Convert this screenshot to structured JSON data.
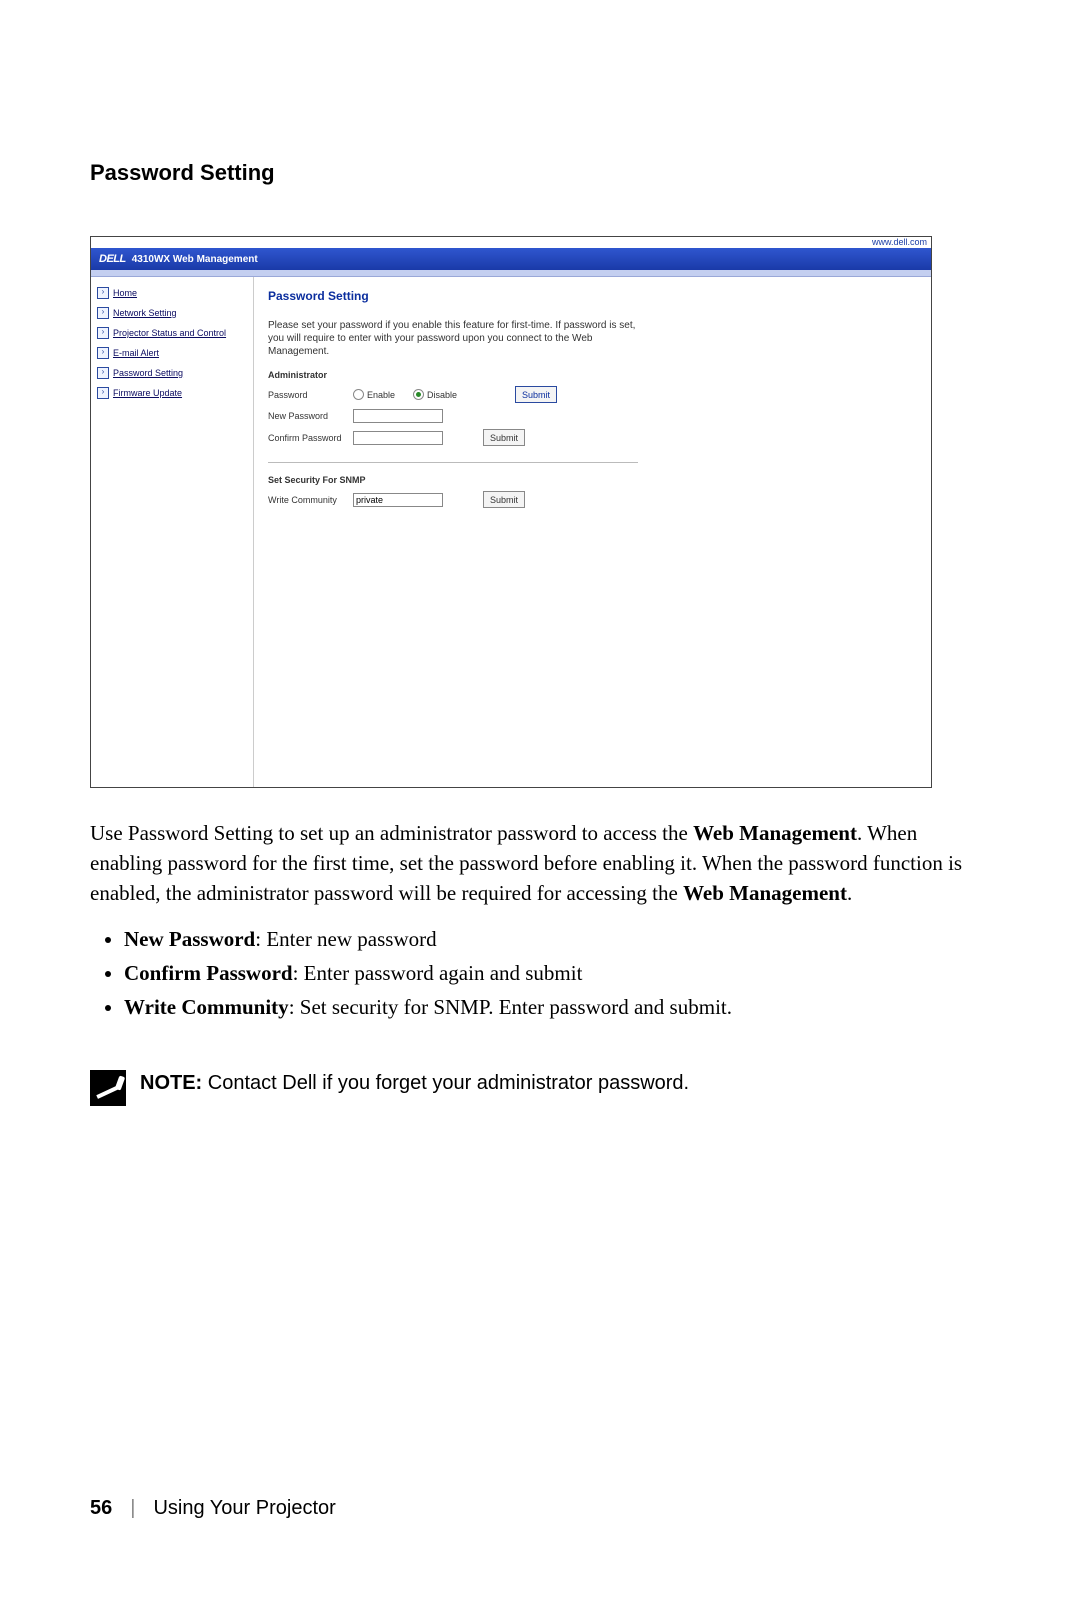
{
  "section_heading": "Password Setting",
  "screenshot": {
    "url_hint": "www.dell.com",
    "title_brand": "DELL",
    "title_text": "4310WX Web Management",
    "sidebar": [
      {
        "label": "Home"
      },
      {
        "label": "Network Setting"
      },
      {
        "label": "Projector Status and Control"
      },
      {
        "label": "E-mail Alert"
      },
      {
        "label": "Password Setting"
      },
      {
        "label": "Firmware Update"
      }
    ],
    "panel_title": "Password Setting",
    "panel_desc": "Please set your password if you enable this feature for first-time. If password is set, you will require to enter with your password upon you connect to the Web Management.",
    "admin": {
      "heading": "Administrator",
      "rows": {
        "password_label": "Password",
        "enable": "Enable",
        "disable": "Disable",
        "submit": "Submit",
        "new_pw_label": "New Password",
        "confirm_pw_label": "Confirm Password",
        "submit2": "Submit"
      }
    },
    "snmp": {
      "heading": "Set Security For SNMP",
      "write_label": "Write Community",
      "write_value": "private",
      "submit": "Submit"
    }
  },
  "paragraph": {
    "pre": "Use Password Setting to set up an administrator password to access the ",
    "b1": "Web Management",
    "mid": ". When enabling password for the first time, set the password before enabling it. When the password function is enabled, the administrator password will be required for accessing the ",
    "b2": "Web Management",
    "post": "."
  },
  "bullets": [
    {
      "b": "New Password",
      "rest": ": Enter new password"
    },
    {
      "b": "Confirm Password",
      "rest": ": Enter password again and submit"
    },
    {
      "b": "Write Community",
      "rest": ": Set security for SNMP. Enter password and submit."
    }
  ],
  "note": {
    "label": "NOTE:",
    "text": " Contact Dell if you forget your administrator password."
  },
  "footer": {
    "page": "56",
    "chapter": "Using Your Projector"
  }
}
